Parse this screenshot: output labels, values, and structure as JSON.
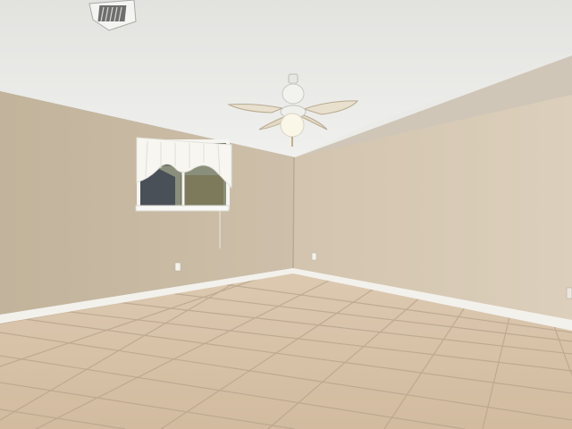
{
  "scene": {
    "description_free": true,
    "colors": {
      "ceiling": "#ededeb",
      "ceiling_shadow": "#dcdcd8",
      "wall_left": "#c6b8a1",
      "wall_back": "#d4c6b1",
      "wall_right": "#d8cab5",
      "floor": "#d7c3a9",
      "grout": "#b8a48b",
      "baseboard": "#f3f1ec",
      "window_frame": "#f5f5f2",
      "curtain": "#f7f6f1",
      "fan_blade": "#e8dfcd",
      "fan_body": "#f2f2ef",
      "fan_light": "#fbf7e8"
    },
    "icons": [
      "ceiling-vent-icon",
      "ceiling-fan-icon",
      "window-icon",
      "outlet-icon"
    ]
  }
}
